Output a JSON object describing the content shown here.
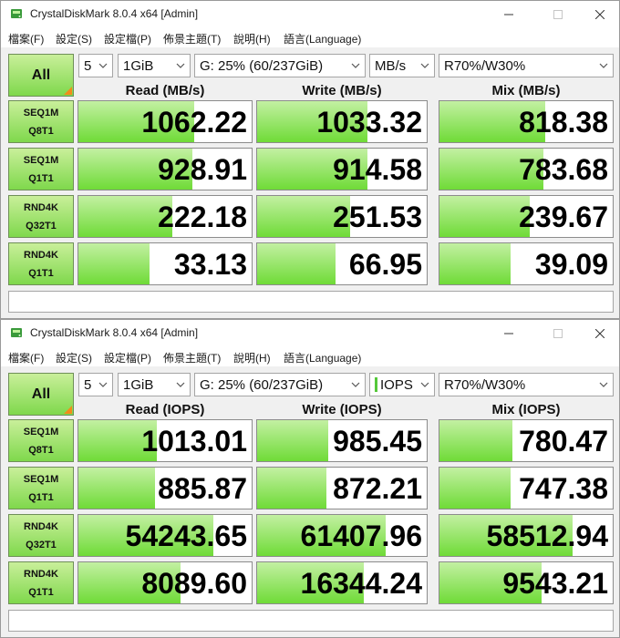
{
  "windows": [
    {
      "title": "CrystalDiskMark 8.0.4 x64 [Admin]",
      "menu": [
        "檔案(F)",
        "設定(S)",
        "設定檔(P)",
        "佈景主題(T)",
        "說明(H)",
        "語言(Language)"
      ],
      "all_label": "All",
      "count_value": "5",
      "size_value": "1GiB",
      "drive_value": "G: 25% (60/237GiB)",
      "unit_value": "MB/s",
      "unit_has_green_marker": false,
      "mix_value": "R70%/W30%",
      "columns": [
        "Read (MB/s)",
        "Write (MB/s)",
        "Mix (MB/s)"
      ],
      "rows": [
        {
          "line1": "SEQ1M",
          "line2": "Q8T1",
          "values": [
            "1062.22",
            "1033.32",
            "818.38"
          ],
          "fill": [
            0.67,
            0.65,
            0.61
          ]
        },
        {
          "line1": "SEQ1M",
          "line2": "Q1T1",
          "values": [
            "928.91",
            "914.58",
            "783.68"
          ],
          "fill": [
            0.66,
            0.65,
            0.6
          ]
        },
        {
          "line1": "RND4K",
          "line2": "Q32T1",
          "values": [
            "222.18",
            "251.53",
            "239.67"
          ],
          "fill": [
            0.54,
            0.55,
            0.52
          ]
        },
        {
          "line1": "RND4K",
          "line2": "Q1T1",
          "values": [
            "33.13",
            "66.95",
            "39.09"
          ],
          "fill": [
            0.41,
            0.46,
            0.41
          ]
        }
      ],
      "status": ""
    },
    {
      "title": "CrystalDiskMark 8.0.4 x64 [Admin]",
      "menu": [
        "檔案(F)",
        "設定(S)",
        "設定檔(P)",
        "佈景主題(T)",
        "說明(H)",
        "語言(Language)"
      ],
      "all_label": "All",
      "count_value": "5",
      "size_value": "1GiB",
      "drive_value": "G: 25% (60/237GiB)",
      "unit_value": "IOPS",
      "unit_has_green_marker": true,
      "mix_value": "R70%/W30%",
      "columns": [
        "Read (IOPS)",
        "Write (IOPS)",
        "Mix (IOPS)"
      ],
      "rows": [
        {
          "line1": "SEQ1M",
          "line2": "Q8T1",
          "values": [
            "1013.01",
            "985.45",
            "780.47"
          ],
          "fill": [
            0.45,
            0.42,
            0.42
          ]
        },
        {
          "line1": "SEQ1M",
          "line2": "Q1T1",
          "values": [
            "885.87",
            "872.21",
            "747.38"
          ],
          "fill": [
            0.44,
            0.41,
            0.41
          ]
        },
        {
          "line1": "RND4K",
          "line2": "Q32T1",
          "values": [
            "54243.65",
            "61407.96",
            "58512.94"
          ],
          "fill": [
            0.78,
            0.76,
            0.77
          ]
        },
        {
          "line1": "RND4K",
          "line2": "Q1T1",
          "values": [
            "8089.60",
            "16344.24",
            "9543.21"
          ],
          "fill": [
            0.59,
            0.63,
            0.59
          ]
        }
      ],
      "status": ""
    }
  ],
  "colors": {
    "accent_green": "#6fdb37",
    "corner_orange": "#f28c1a"
  },
  "icons": [
    "app-disk-icon",
    "minimize-icon",
    "maximize-icon",
    "close-icon",
    "chevron-down-icon"
  ]
}
